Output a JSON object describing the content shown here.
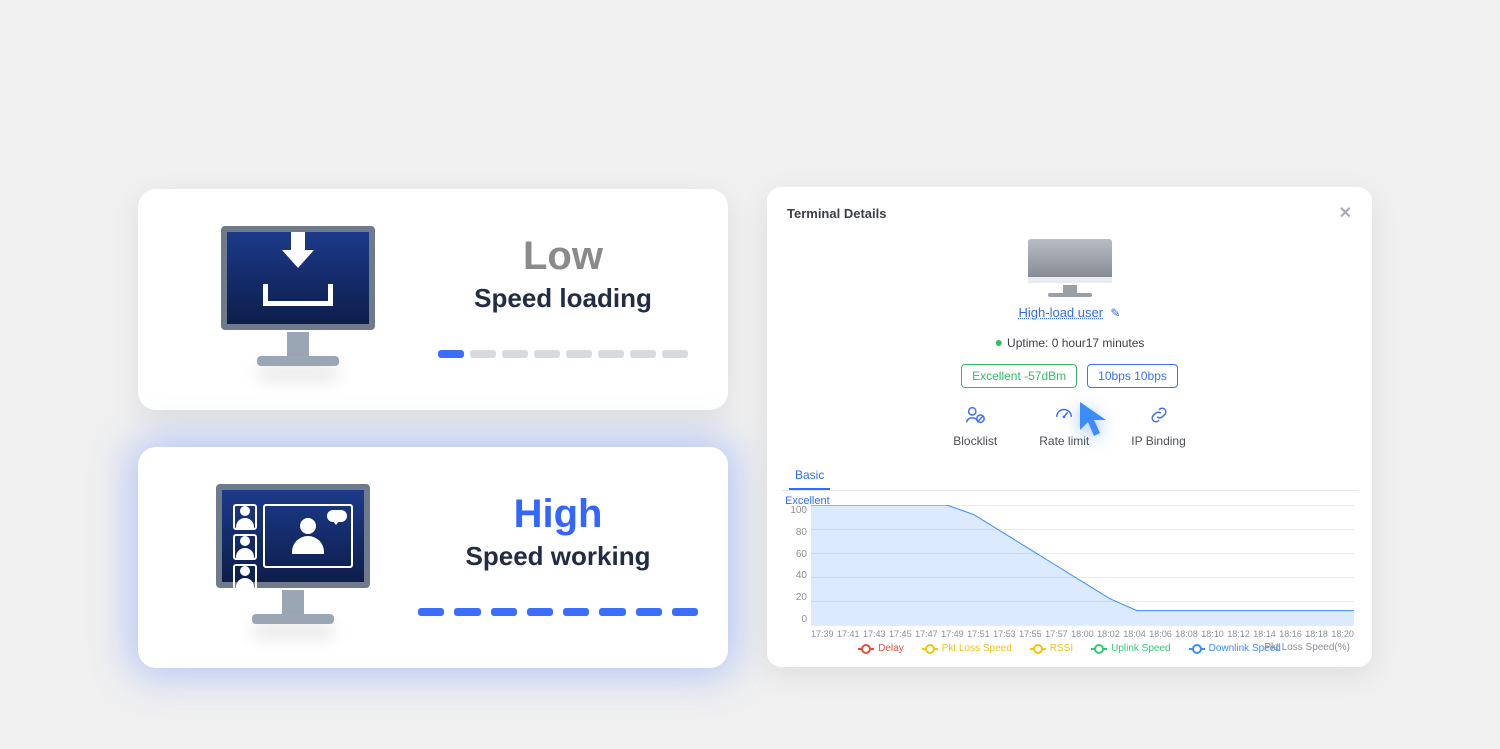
{
  "left_cards": {
    "low": {
      "title": "Low",
      "subtitle": "Speed loading",
      "progress_segments": 8,
      "progress_filled": 1
    },
    "high": {
      "title": "High",
      "subtitle": "Speed working",
      "progress_segments": 8
    }
  },
  "panel": {
    "title": "Terminal Details",
    "device_name": "High-load user",
    "uptime": "Uptime: 0 hour17 minutes",
    "signal_tag": "Excellent -57dBm",
    "speed_tag": "10bps  10bps",
    "actions": {
      "blocklist": "Blocklist",
      "ratelimit": "Rate limit",
      "ipbinding": "IP Binding"
    },
    "tab": "Basic",
    "chart_excellent_label": "Excellent",
    "footer_note": "Pkt Loss Speed(%)",
    "legend": {
      "delay": "Delay",
      "pktloss": "Pkt Loss Speed",
      "rssi": "RSSI",
      "uplink": "Uplink Speed",
      "downlink": "Downlink Speed"
    }
  },
  "chart_data": {
    "type": "area",
    "title": "",
    "ylabel": "",
    "ylim": [
      0,
      100
    ],
    "y_ticks": [
      100,
      80,
      60,
      40,
      20,
      0
    ],
    "x_ticks": [
      "17:39",
      "17:41",
      "17:43",
      "17:45",
      "17:47",
      "17:49",
      "17:51",
      "17:53",
      "17:55",
      "17:57",
      "18:00",
      "18:02",
      "18:04",
      "18:06",
      "18:08",
      "18:10",
      "18:12",
      "18:14",
      "18:16",
      "18:18",
      "18:20"
    ],
    "series": [
      {
        "name": "Downlink Speed",
        "color": "#3b8cff",
        "values": [
          100,
          100,
          100,
          100,
          100,
          100,
          92,
          78,
          64,
          50,
          36,
          22,
          12,
          12,
          12,
          12,
          12,
          12,
          12,
          12,
          12
        ]
      }
    ],
    "legend_colors": {
      "delay": "#e74c3c",
      "pktloss": "#f1c40f",
      "rssi": "#f1c40f",
      "uplink": "#2ecc71",
      "downlink": "#3b8cff"
    }
  }
}
